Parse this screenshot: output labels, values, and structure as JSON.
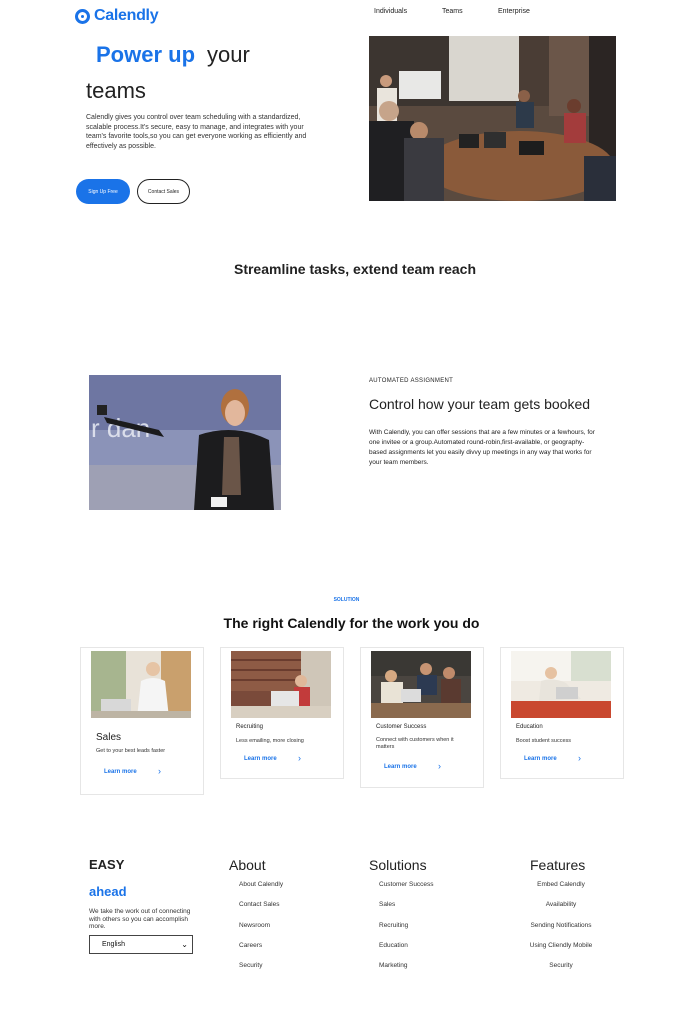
{
  "header": {
    "brand": "Calendly",
    "nav": [
      "Individuals",
      "Teams",
      "Enterprise"
    ]
  },
  "hero": {
    "title_accent": "Power up",
    "title_rest": "your",
    "title_line2": "teams",
    "description": "Calendly gives you control over team scheduling with a standardized, scalable process.It's secure, easy to manage, and integrates with your team's favorite tools,so you can get everyone working as efficiently and effectively as possible.",
    "primary_button": "Sign Up Free",
    "secondary_button": "Contact Sales"
  },
  "streamline": {
    "title": "Streamline tasks, extend team reach"
  },
  "feature": {
    "eyebrow": "AUTOMATED ASSIGNMENT",
    "title": "Control how your team gets booked",
    "description": "With Calendly, you can offer sessions that are a few minutes or a fewhours, for one invitee or a group.Automated round-robin,first-available, or geography-based assignments let you easily divvy up meetings in any way that works for your team members."
  },
  "solutions": {
    "eyebrow": "SOLUTION",
    "title": "The right Calendly for the work you do",
    "cards": [
      {
        "label": "Sales",
        "sub": "Get to your best leads faster",
        "link": "Learn more"
      },
      {
        "label": "Recruiting",
        "sub": "Less emailing, more closing",
        "link": "Learn more"
      },
      {
        "label": "Customer Success",
        "sub": "Connect with customers when it matters",
        "link": "Learn more"
      },
      {
        "label": "Education",
        "sub": "Boost student success",
        "link": "Learn more"
      }
    ]
  },
  "footer": {
    "brand_line1": "EASY",
    "brand_line2": "ahead",
    "tagline": "We take the work out of connecting with others so you can accomplish more.",
    "language": "English",
    "columns": [
      {
        "heading": "About",
        "links": [
          "About Calendly",
          "Contact Sales",
          "Newsroom",
          "Careers",
          "Security"
        ]
      },
      {
        "heading": "Solutions",
        "links": [
          "Customer Success",
          "Sales",
          "Recruiting",
          "Education",
          "Marketing"
        ]
      },
      {
        "heading": "Features",
        "links": [
          "Embed Calendly",
          "Availability",
          "Sending Notifications",
          "Using Cliendly Mobile",
          "Security"
        ]
      }
    ]
  },
  "colors": {
    "accent": "#1a73e8",
    "text": "#222222",
    "background": "#ffffff"
  }
}
